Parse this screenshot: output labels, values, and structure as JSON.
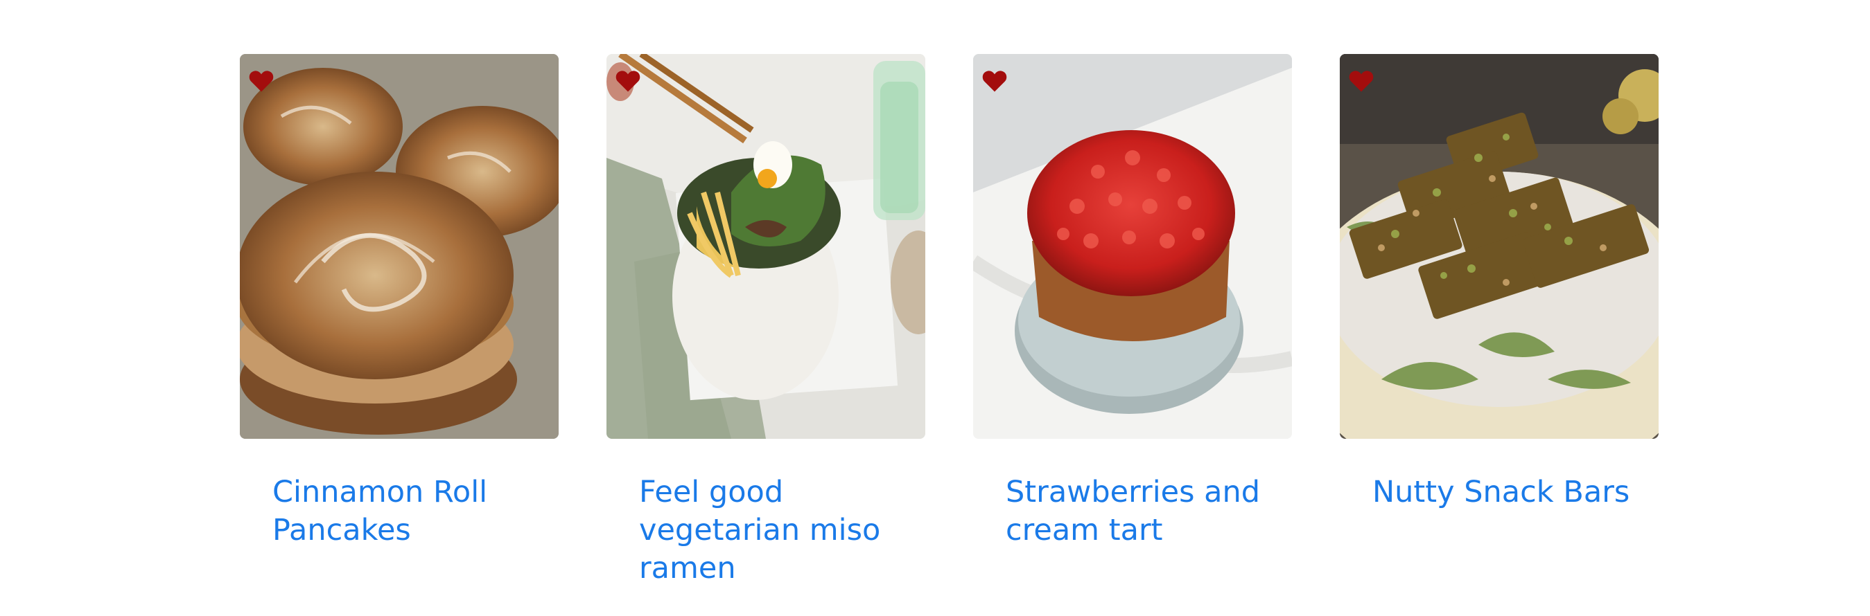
{
  "recipes": [
    {
      "title": "Cinnamon Roll Pancakes",
      "image_icon": "pancakes-photo",
      "favorite_icon": "heart-icon"
    },
    {
      "title": "Feel good vegetarian miso ramen",
      "image_icon": "ramen-photo",
      "favorite_icon": "heart-icon"
    },
    {
      "title": "Strawberries and cream tart",
      "image_icon": "tart-photo",
      "favorite_icon": "heart-icon"
    },
    {
      "title": "Nutty Snack Bars",
      "image_icon": "snack-bars-photo",
      "favorite_icon": "heart-icon"
    }
  ],
  "colors": {
    "title_link": "#1a7ae8",
    "heart": "#a30d0d",
    "background": "#ffffff"
  }
}
